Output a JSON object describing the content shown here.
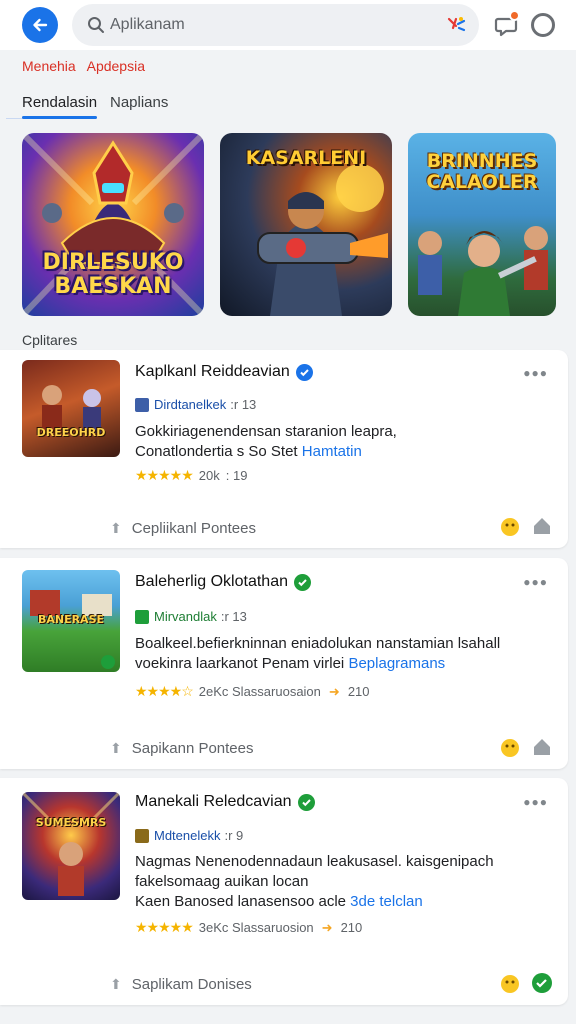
{
  "search": {
    "placeholder": "Aplikanam"
  },
  "breadcrumb": "Menehia   Apdepsia",
  "tabs": [
    {
      "label": "Rendalasin"
    },
    {
      "label": "Naplians"
    }
  ],
  "banners": [
    {
      "title": "DIRLESUKO BAESKAN"
    },
    {
      "title": "KASARLENI"
    },
    {
      "title": "BRINNHES CALAOLER"
    }
  ],
  "section_label": "Cplitares",
  "apps": [
    {
      "name": "Kaplkanl Reiddeavian",
      "developer": "Dirdtanelkek",
      "developer_meta": ":r 13",
      "desc_line1": "Gokkiriagenendensan staranion leapra,",
      "desc_line2": "Conatlondertia s So Stet",
      "desc_link": "Hamtatin",
      "rating_count": "20k",
      "rating_extra": ": 19",
      "footer_label": "Cepliikanl Pontees",
      "thumb_text": "DREEOHRD"
    },
    {
      "name": "Baleherlig Oklotathan",
      "developer": "Mirvandlak",
      "developer_meta": ":r 13",
      "desc_line1": "Boalkeel.befierkninnan eniadolukan nanstamian lsahall",
      "desc_line2": "voekinra laarkanot Penam virlei",
      "desc_link": "Beplagramans",
      "rating_count": "2eKc Slassaruosaion",
      "rating_extra": "210",
      "footer_label": "Sapikann Pontees",
      "thumb_text": "BANERASE"
    },
    {
      "name": "Manekali Reledcavian",
      "developer": "Mdtenelekk",
      "developer_meta": ":r 9",
      "desc_line1": "Nagmas Nenenodennadaun leakusasel. kaisgenipach",
      "desc_line2": "fakelsomaag auikan locan",
      "desc_line3": "Kaen Banosed lanasensoo acle",
      "desc_link": "3de telclan",
      "rating_count": "3eKc Slassaruosion",
      "rating_extra": "210",
      "footer_label": "Saplikam Donises",
      "thumb_text": "SUMESMRS"
    }
  ],
  "colors": {
    "accent": "#1a73e8",
    "verified_blue": "#1a73e8",
    "verified_green": "#1e9e3a",
    "breadcrumb": "#d93025",
    "star": "#f5b400"
  }
}
